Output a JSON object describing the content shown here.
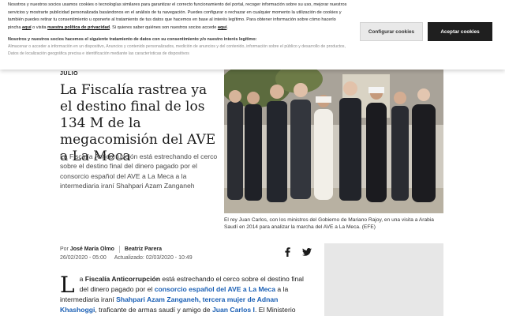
{
  "cookie": {
    "text_part1": "Nosotros y nuestros socios usamos cookies o tecnologías similares para garantizar el correcto funcionamiento del portal, recoger información sobre su uso, mejorar nuestros servicios y mostrarte publicidad personalizada basándonos en el análisis de tu navegación. Puedes configurar o rechazar en cualquier momento la utilización de cookies y también puedes retirar tu consentimiento u oponerte al tratamiento de tus datos que hacemos en base al interés legítimo. Para obtener información sobre cómo hacerlo pincha ",
    "link_aqui_1": "aquí",
    "text_part2": " o visita ",
    "link_policy": "nuestra política de privacidad",
    "text_part3": ". Si quieres saber quiénes son nuestros socios accede ",
    "link_aqui_2": "aquí",
    "text_part4": ".",
    "sub_title": "Nosotros y nuestros socios hacemos el siguiente tratamiento de datos con su consentimiento y/o nuestro interés legítimo:",
    "sub_text": "Almacenar o acceder a información en un dispositivo, Anuncios y contenido personalizados, medición de anuncios y del contenido, información sobre el público y desarrollo de productos, Datos de localización geográfica precisa e identificación mediante las características de dispositivos",
    "config_label": "Configurar cookies",
    "accept_label": "Aceptar cookies"
  },
  "article": {
    "kicker": "JULIO",
    "headline": "La Fiscalía rastrea ya el destino final de los 134 M de la megacomisión del AVE a La Meca",
    "lead": "La Fiscalía Anticorrupción está estrechando el cerco sobre el destino final del dinero pagado por el consorcio español del AVE a La Meca a la intermediaria iraní Shahpari Azam Zanganeh",
    "caption": "El rey Juan Carlos, con los ministros del Gobierno de Mariano Rajoy, en una visita a Arabia Saudí en 2014 para analizar la marcha del AVE a La Meca. (EFE)",
    "byline_prefix": "Por",
    "author1": "José María Olmo",
    "author2": "Beatriz Parera",
    "published": "26/02/2020 - 05:00",
    "updated": "Actualizado: 02/03/2020 - 10:49",
    "body": {
      "dropcap": "L",
      "s1": "a ",
      "b1": "Fiscalía Anticorrupción",
      "s2": " está estrechando el cerco sobre el destino final del dinero pagado por el ",
      "l1": "consorcio español del AVE a La Meca",
      "s3": " a la intermediaria iraní ",
      "l2": "Shahpari Azam Zanganeh, tercera mujer de Adnan Khashoggi",
      "s4": ", traficante de armas saudí y amigo de ",
      "l3": "Juan Carlos I",
      "s5": ". El Ministerio"
    }
  },
  "colors": {
    "accent_link": "#1a5fb4",
    "accept_bg": "#1f1f1f",
    "config_bg": "#e9e9e9"
  },
  "icons": {
    "share_facebook": "facebook-icon",
    "share_twitter": "twitter-icon"
  }
}
